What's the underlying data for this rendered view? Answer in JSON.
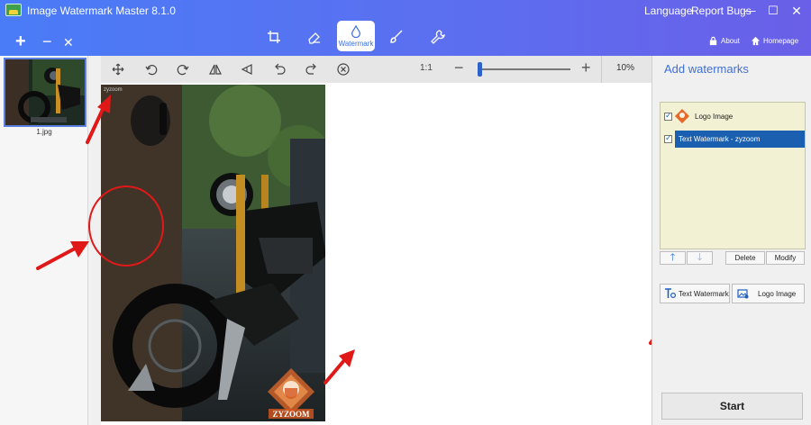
{
  "titlebar": {
    "app_title": "Image Watermark Master 8.1.0",
    "menu_language": "Language",
    "menu_report_bugs": "Report Bugs",
    "about_label": "About",
    "homepage_label": "Homepage"
  },
  "toolbar_tabs": {
    "active_label": "Watermark"
  },
  "thumbnails": [
    {
      "label": "1.jpg"
    }
  ],
  "canvas_toolbar": {
    "zoom_fit_label": "1:1",
    "zoom_percent": "10%",
    "zoom_slider_fraction": 0.03
  },
  "canvas": {
    "text_watermark": "zyzoom",
    "logo_text": "ZYZOOM"
  },
  "right_panel": {
    "title": "Add watermarks",
    "watermarks": [
      {
        "label": "Logo Image",
        "checked": true,
        "selected": false
      },
      {
        "label": "Text Watermark - zyzoom",
        "checked": true,
        "selected": true
      }
    ],
    "delete_label": "Delete",
    "modify_label": "Modify",
    "text_watermark_button": "Text Watermark",
    "logo_image_button": "Logo Image",
    "start_label": "Start"
  },
  "colors": {
    "titlebar_gradient_start": "#4a7cf7",
    "titlebar_gradient_end": "#6a5fe8",
    "accent_blue": "#3f6fd6",
    "selection_blue": "#1b5fb0",
    "list_background": "#f3f1d3",
    "annotation_red": "#e01818"
  }
}
